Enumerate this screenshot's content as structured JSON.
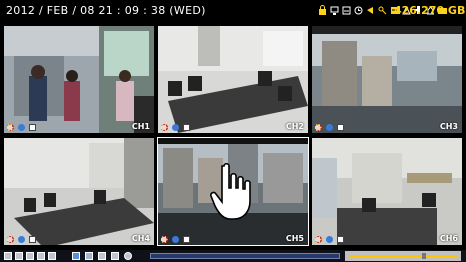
{
  "topbar": {
    "datetime": "2012 / FEB / 08  21 : 09 : 38 (WED)",
    "hdd_space": "426.270 GB",
    "status_icons": [
      "lock-icon",
      "network-icon",
      "hdd-icon",
      "clock-icon",
      "alarm-icon",
      "key-icon",
      "overwrite-icon",
      "record-icon",
      "usb-icon",
      "timer-icon",
      "hdd-status-icon"
    ]
  },
  "channels": [
    {
      "label": "CH1"
    },
    {
      "label": "CH2"
    },
    {
      "label": "CH3"
    },
    {
      "label": "CH4"
    },
    {
      "label": "CH5"
    },
    {
      "label": "CH6"
    }
  ],
  "bottombar": {
    "playback_progress": 0.0,
    "panel_position": 0.7
  },
  "colors": {
    "accent": "#ffd21a",
    "record": "#d01818",
    "motion": "#ffcc00",
    "info": "#3a7bd5"
  }
}
